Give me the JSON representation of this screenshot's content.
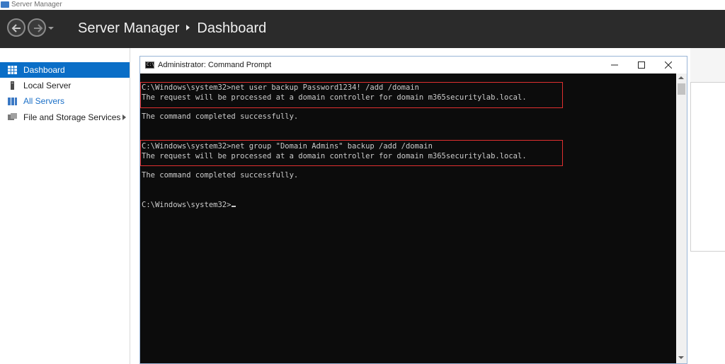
{
  "window": {
    "title": "Server Manager"
  },
  "header": {
    "breadcrumb_root": "Server Manager",
    "breadcrumb_current": "Dashboard"
  },
  "sidebar": {
    "items": [
      {
        "label": "Dashboard",
        "icon": "dashboard-grid-icon",
        "active": true
      },
      {
        "label": "Local Server",
        "icon": "server-icon",
        "active": false
      },
      {
        "label": "All Servers",
        "icon": "servers-icon",
        "active": false
      },
      {
        "label": "File and Storage Services",
        "icon": "storage-icon",
        "active": false
      }
    ]
  },
  "cmd": {
    "title": "Administrator: Command Prompt",
    "icon_text": "C:\\",
    "lines": [
      "C:\\Windows\\system32>net user backup Password1234! /add /domain",
      "The request will be processed at a domain controller for domain m365securitylab.local.",
      "The command completed successfully.",
      "C:\\Windows\\system32>net group \"Domain Admins\" backup /add /domain",
      "The request will be processed at a domain controller for domain m365securitylab.local.",
      "The command completed successfully.",
      "C:\\Windows\\system32>"
    ]
  },
  "colors": {
    "header_bg": "#2b2b2b",
    "active_item": "#0a6ec7",
    "console_bg": "#0c0c0c",
    "console_text": "#cccccc",
    "highlight_border": "#e03030"
  }
}
